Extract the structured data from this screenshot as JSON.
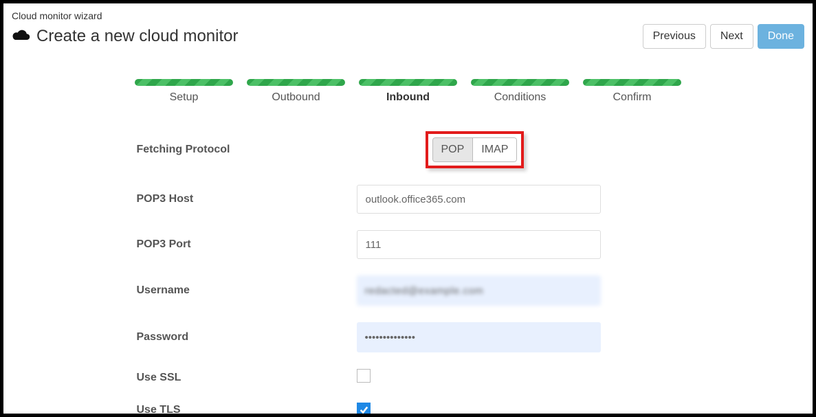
{
  "breadcrumb": "Cloud monitor wizard",
  "page_title": "Create a new cloud monitor",
  "actions": {
    "previous": "Previous",
    "next": "Next",
    "done": "Done"
  },
  "steps": [
    {
      "label": "Setup",
      "active": false
    },
    {
      "label": "Outbound",
      "active": false
    },
    {
      "label": "Inbound",
      "active": true
    },
    {
      "label": "Conditions",
      "active": false
    },
    {
      "label": "Confirm",
      "active": false
    }
  ],
  "form": {
    "fetching_protocol": {
      "label": "Fetching Protocol",
      "options": {
        "pop": "POP",
        "imap": "IMAP"
      },
      "selected": "pop"
    },
    "pop3_host": {
      "label": "POP3 Host",
      "value": "outlook.office365.com"
    },
    "pop3_port": {
      "label": "POP3 Port",
      "value": "111"
    },
    "username": {
      "label": "Username",
      "value": "redacted@example.com"
    },
    "password": {
      "label": "Password",
      "value": "••••••••••••••"
    },
    "use_ssl": {
      "label": "Use SSL",
      "checked": false
    },
    "use_tls": {
      "label": "Use TLS",
      "checked": true
    }
  }
}
